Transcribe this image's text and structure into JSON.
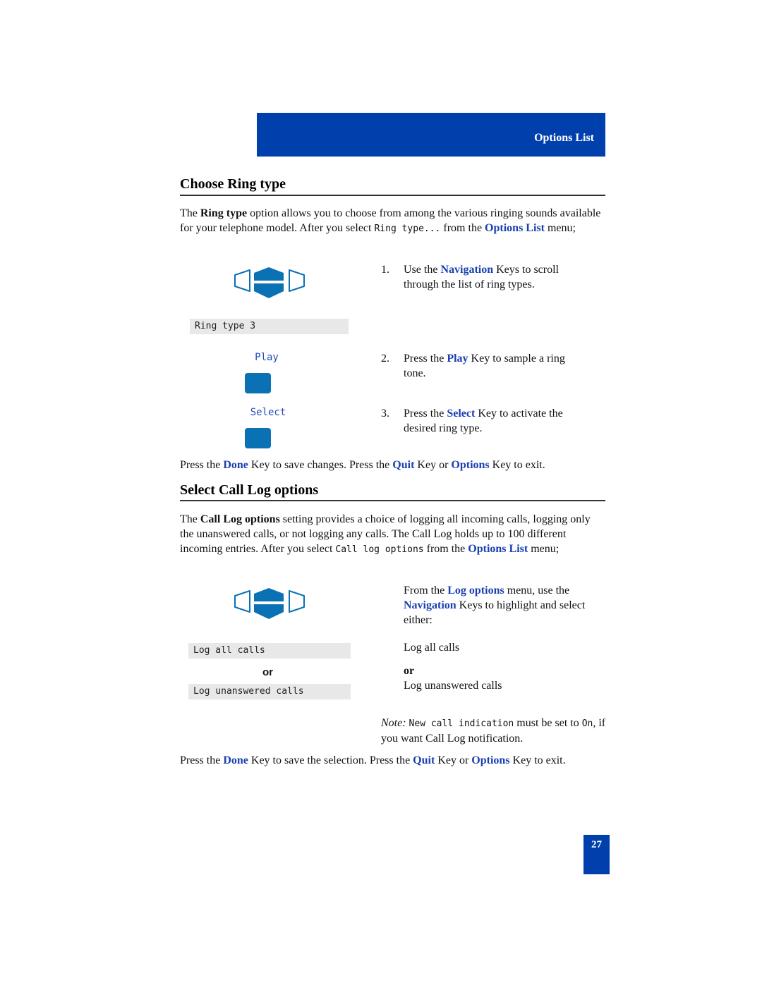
{
  "header": {
    "section_label": "Options List"
  },
  "section1": {
    "title": "Choose Ring type",
    "intro": {
      "t1": "The ",
      "b1": "Ring type",
      "t2": " option allows you to choose from among the various ringing sounds available for your telephone model. After you select ",
      "mono": "Ring type...",
      "t3": " from the ",
      "link": "Options List",
      "t4": " menu;"
    },
    "display_text": "Ring type 3",
    "softkeys": [
      {
        "label": "Play"
      },
      {
        "label": "Select"
      }
    ],
    "steps": [
      {
        "num": "1.",
        "pre": "Use the ",
        "key": "Navigation",
        "post": " Keys to scroll through the list of ring types."
      },
      {
        "num": "2.",
        "pre": "Press the ",
        "key": "Play",
        "post": " Key to sample a ring tone."
      },
      {
        "num": "3.",
        "pre": "Press the ",
        "key": "Select",
        "post": " Key to activate the desired ring type."
      }
    ],
    "footer": {
      "t1": "Press the ",
      "k1": "Done",
      "t2": " Key to save changes. Press the ",
      "k2": "Quit",
      "t3": " Key or ",
      "k3": "Options",
      "t4": " Key to exit."
    }
  },
  "section2": {
    "title": "Select Call Log options",
    "intro": {
      "t1": "The ",
      "b1": "Call Log options",
      "t2": " setting provides a choice of logging all incoming calls, logging only the unanswered calls, or not logging any calls. The Call Log holds up to 100 different incoming entries. After you select ",
      "mono": "Call log options",
      "t3": " from the ",
      "link": "Options List",
      "t4": " menu;"
    },
    "display_option1": "Log all calls",
    "display_or": "or",
    "display_option2": "Log unanswered calls",
    "instruction": {
      "t1": "From the ",
      "k1": "Log options",
      "t2": " menu, use the ",
      "k2": "Navigation",
      "t3": " Keys to highlight and select either:"
    },
    "option1": "Log all calls",
    "or": "or",
    "option2": "Log unanswered calls",
    "note": {
      "label": "Note:",
      "mono1": "New call indication",
      "t1": " must be set to ",
      "mono2": "On",
      "t2": ", if you want Call Log notification."
    },
    "footer": {
      "t1": "Press the ",
      "k1": "Done",
      "t2": " Key to save the selection. Press the ",
      "k2": "Quit",
      "t3": " Key or ",
      "k3": "Options",
      "t4": " Key to exit."
    }
  },
  "page_number": "27"
}
